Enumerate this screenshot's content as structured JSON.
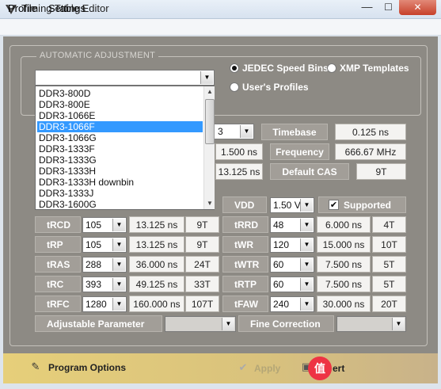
{
  "window": {
    "title": "Timing Table Editor",
    "minimize": "—",
    "maximize": "☐",
    "close": "✕"
  },
  "menu": {
    "items": [
      "Profile",
      "Settings"
    ]
  },
  "auto_adjust": {
    "title": "AUTOMATIC ADJUSTMENT",
    "radio_jedec": "JEDEC Speed Bins",
    "radio_xmp": "XMP Templates",
    "radio_user": "User's Profiles",
    "selected_radio": "JEDEC Speed Bins",
    "profile_combo_value": ""
  },
  "dropdown": {
    "options": [
      "DDR3-800D",
      "DDR3-800E",
      "DDR3-1066E",
      "DDR3-1066F",
      "DDR3-1066G",
      "DDR3-1333F",
      "DDR3-1333G",
      "DDR3-1333H",
      "DDR3-1333H downbin",
      "DDR3-1333J",
      "DDR3-1600G"
    ],
    "selected_index": 3
  },
  "info": {
    "partial_combo": "3",
    "partial_val1": "1.500 ns",
    "partial_val2": "13.125 ns",
    "timebase_label": "Timebase",
    "timebase_value": "0.125 ns",
    "frequency_label": "Frequency",
    "frequency_value": "666.67 MHz",
    "cas_label": "Default CAS",
    "cas_value": "9T"
  },
  "vdd": {
    "label": "VDD",
    "value": "1.50 V",
    "supported_label": "Supported",
    "supported_checked": true
  },
  "timings_left": [
    {
      "label": "tRCD",
      "combo": "105",
      "ns": "13.125 ns",
      "t": "9T"
    },
    {
      "label": "tRP",
      "combo": "105",
      "ns": "13.125 ns",
      "t": "9T"
    },
    {
      "label": "tRAS",
      "combo": "288",
      "ns": "36.000 ns",
      "t": "24T"
    },
    {
      "label": "tRC",
      "combo": "393",
      "ns": "49.125 ns",
      "t": "33T"
    },
    {
      "label": "tRFC",
      "combo": "1280",
      "ns": "160.000 ns",
      "t": "107T"
    }
  ],
  "timings_right": [
    {
      "label": "tRRD",
      "combo": "48",
      "ns": "6.000 ns",
      "t": "4T"
    },
    {
      "label": "tWR",
      "combo": "120",
      "ns": "15.000 ns",
      "t": "10T"
    },
    {
      "label": "tWTR",
      "combo": "60",
      "ns": "7.500 ns",
      "t": "5T"
    },
    {
      "label": "tRTP",
      "combo": "60",
      "ns": "7.500 ns",
      "t": "5T"
    },
    {
      "label": "tFAW",
      "combo": "240",
      "ns": "30.000 ns",
      "t": "20T"
    }
  ],
  "adjust": {
    "param_label": "Adjustable Parameter",
    "fine_label": "Fine Correction"
  },
  "bottom": {
    "program_options": "Program Options",
    "apply": "Apply",
    "revert_partial": "ert"
  },
  "colors": {
    "panel": "#8d8a84",
    "label_bg": "#a29e98",
    "selection": "#3399ff",
    "bottom_bar": "#d8c27a"
  }
}
